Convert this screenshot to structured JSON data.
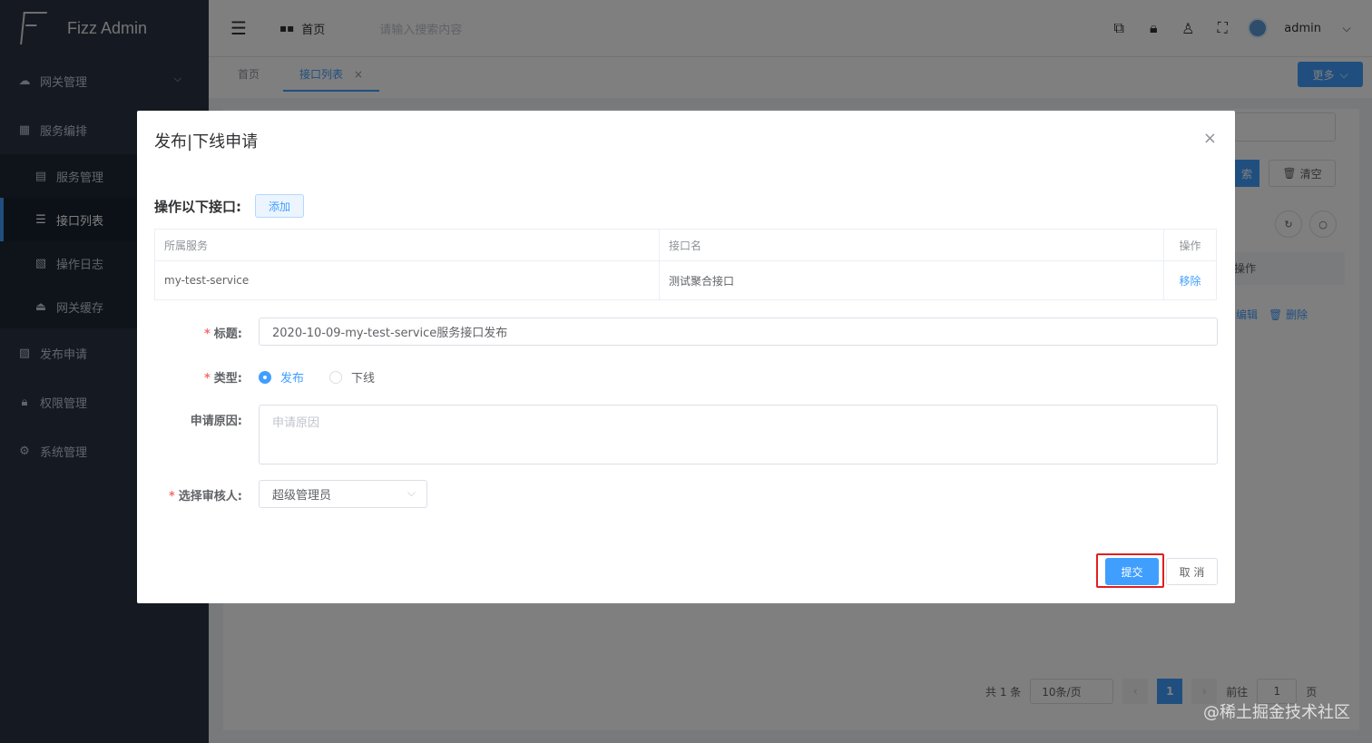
{
  "app": {
    "title": "Fizz Admin"
  },
  "sidebar": {
    "items": [
      {
        "label": "网关管理",
        "icon": "cloud-icon",
        "sub": false,
        "active": false
      },
      {
        "label": "服务编排",
        "icon": "grid-icon",
        "sub": false,
        "active": false
      },
      {
        "label": "服务管理",
        "icon": "doc-icon",
        "sub": true,
        "active": false
      },
      {
        "label": "接口列表",
        "icon": "list-icon",
        "sub": true,
        "active": true
      },
      {
        "label": "操作日志",
        "icon": "log-icon",
        "sub": true,
        "active": false
      },
      {
        "label": "网关缓存",
        "icon": "cache-icon",
        "sub": true,
        "active": false
      },
      {
        "label": "发布申请",
        "icon": "publish-icon",
        "sub": false,
        "active": false
      },
      {
        "label": "权限管理",
        "icon": "lock-icon",
        "sub": false,
        "active": false
      },
      {
        "label": "系统管理",
        "icon": "gear-icon",
        "sub": false,
        "active": false
      }
    ]
  },
  "header": {
    "home": "首页",
    "search_placeholder": "请输入搜索内容",
    "username": "admin"
  },
  "tabs": [
    {
      "label": "首页",
      "active": false
    },
    {
      "label": "接口列表",
      "active": true,
      "close": "×"
    }
  ],
  "more_button": "更多",
  "background": {
    "search_btn": "索",
    "clear_btn": "清空",
    "col_op": "操作",
    "edit": "编辑",
    "delete": "删除",
    "pager": {
      "total": "共 1 条",
      "page_size": "10条/页",
      "current": "1",
      "goto": "前往",
      "goto_value": "1",
      "page_unit": "页"
    }
  },
  "dialog": {
    "title": "发布|下线申请",
    "close": "×",
    "section_label": "操作以下接口:",
    "add_button": "添加",
    "table": {
      "headers": [
        "所属服务",
        "接口名",
        "操作"
      ],
      "rows": [
        {
          "service": "my-test-service",
          "api": "测试聚合接口",
          "action": "移除"
        }
      ]
    },
    "form": {
      "title_label": "标题:",
      "title_value": "2020-10-09-my-test-service服务接口发布",
      "type_label": "类型:",
      "type_options": [
        "发布",
        "下线"
      ],
      "type_selected": "发布",
      "reason_label": "申请原因:",
      "reason_placeholder": "申请原因",
      "reviewer_label": "选择审核人:",
      "reviewer_value": "超级管理员"
    },
    "submit": "提交",
    "cancel": "取 消"
  },
  "watermark": "@稀土掘金技术社区",
  "colors": {
    "primary": "#409eff",
    "sidebar_bg": "#2b3544",
    "highlight": "#e02020",
    "required": "#f56c6c"
  }
}
